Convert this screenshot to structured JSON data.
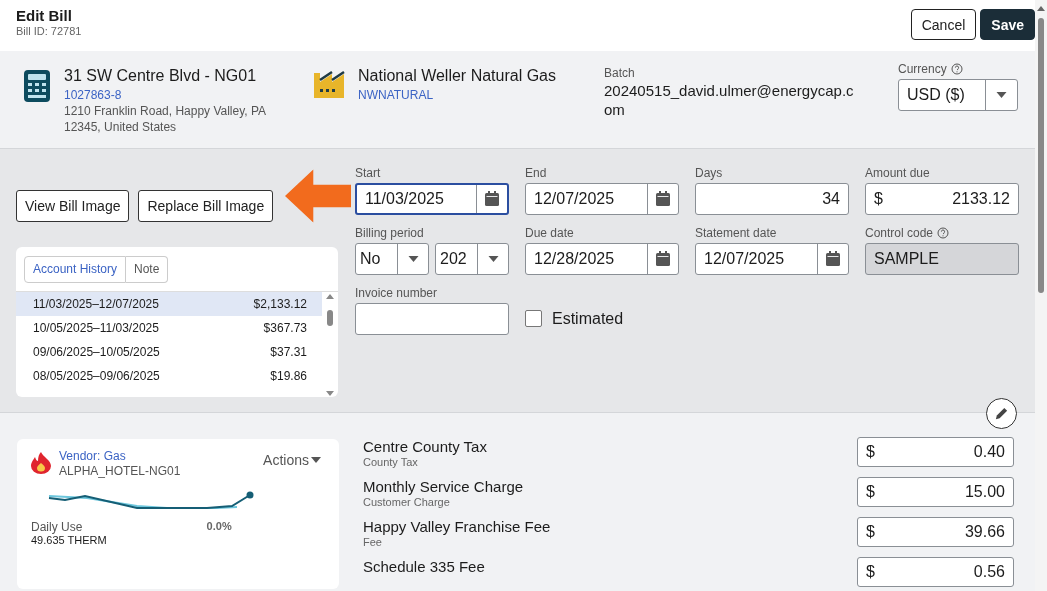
{
  "header": {
    "title": "Edit Bill",
    "bill_id": "Bill ID: 72781",
    "actions": [
      {
        "label": "Cancel",
        "kind": "secondary"
      },
      {
        "label": "Save",
        "kind": "primary"
      }
    ]
  },
  "account": {
    "name": "31 SW Centre Blvd - NG01",
    "number": "1027863-8",
    "address_lines": [
      "1210 Franklin Road, Happy Valley, PA",
      "12345, United States"
    ]
  },
  "vendor": {
    "name": "National Weller Natural Gas",
    "code": "NWNATURAL"
  },
  "batch": {
    "label": "Batch",
    "value": "20240515_david.ulmer@energycap.com"
  },
  "currency": {
    "label": "Currency",
    "value": "USD ($)"
  },
  "image_buttons": [
    "View Bill Image",
    "Replace Bill Image"
  ],
  "history": {
    "tabs": [
      {
        "label": "Account History",
        "selected": true
      },
      {
        "label": "Note",
        "selected": false
      }
    ],
    "rows": [
      {
        "period": "11/03/2025–12/07/2025",
        "amount": "$2,133.12",
        "selected": true
      },
      {
        "period": "10/05/2025–11/03/2025",
        "amount": "$367.73",
        "selected": false
      },
      {
        "period": "09/06/2025–10/05/2025",
        "amount": "$37.31",
        "selected": false
      },
      {
        "period": "08/05/2025–09/06/2025",
        "amount": "$19.86",
        "selected": false
      }
    ]
  },
  "fields": [
    {
      "kind": "date",
      "label": "Start",
      "value": "11/03/2025",
      "focused": true
    },
    {
      "kind": "date",
      "label": "End",
      "value": "12/07/2025",
      "focused": false
    },
    {
      "kind": "number",
      "label": "Days",
      "value": "34",
      "focused": false
    },
    {
      "kind": "money",
      "label": "Amount due",
      "symbol": "$",
      "value": "2133.12",
      "focused": false
    },
    {
      "kind": "select-pair",
      "label": "Billing period",
      "values": [
        "No",
        "202"
      ],
      "focused": false
    },
    {
      "kind": "date",
      "label": "Due date",
      "value": "12/28/2025",
      "focused": false
    },
    {
      "kind": "date",
      "label": "Statement date",
      "value": "12/07/2025",
      "focused": false
    },
    {
      "kind": "readonly",
      "label": "Control code",
      "value": "SAMPLE",
      "focused": false
    },
    {
      "kind": "text",
      "label": "Invoice number",
      "focused": false
    },
    {
      "kind": "checkbox",
      "label": "Estimated",
      "checked": false
    }
  ],
  "usage": {
    "commodity": "Vendor: Gas",
    "meter": "ALPHA_HOTEL-NG01",
    "actions": "Actions",
    "metric_label": "Daily Use",
    "metric_value": "49.635 THERM",
    "change": "0.0%"
  },
  "charges": [
    {
      "name": "Centre County Tax",
      "type": "County Tax",
      "symbol": "$",
      "amount": "0.40"
    },
    {
      "name": "Monthly Service Charge",
      "type": "Customer Charge",
      "symbol": "$",
      "amount": "15.00"
    },
    {
      "name": "Happy Valley Franchise Fee",
      "type": "Fee",
      "symbol": "$",
      "amount": "39.66"
    },
    {
      "name": "Schedule 335 Fee",
      "symbol": "$",
      "amount": "0.56"
    }
  ]
}
